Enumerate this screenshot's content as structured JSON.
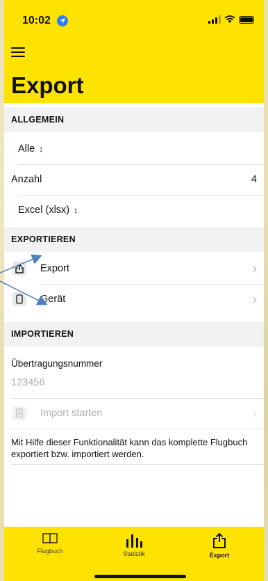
{
  "status_bar": {
    "time": "10:02"
  },
  "page_title": "Export",
  "sections": {
    "allgemein": "ALLGEMEIN",
    "exportieren": "EXPORTIEREN",
    "importieren": "IMPORTIEREN"
  },
  "allgemein": {
    "filter_value": "Alle",
    "anzahl_label": "Anzahl",
    "anzahl_value": "4",
    "format_value": "Excel (xlsx)"
  },
  "exportieren": {
    "export_label": "Export",
    "geraet_label": "Gerät"
  },
  "importieren": {
    "transfer_label": "Übertragungsnummer",
    "transfer_value": "123456",
    "import_label": "Import starten"
  },
  "footer_note": "Mit Hilfe dieser Funktionalität kann das komplette Flugbuch exportiert bzw. importiert werden.",
  "tabs": [
    {
      "label": "Flugbuch",
      "icon": "book-icon"
    },
    {
      "label": "Statistik",
      "icon": "chart-icon"
    },
    {
      "label": "Export",
      "icon": "share-icon"
    }
  ],
  "colors": {
    "accent": "#ffe300",
    "annotation_arrow": "#4f7fbf"
  }
}
